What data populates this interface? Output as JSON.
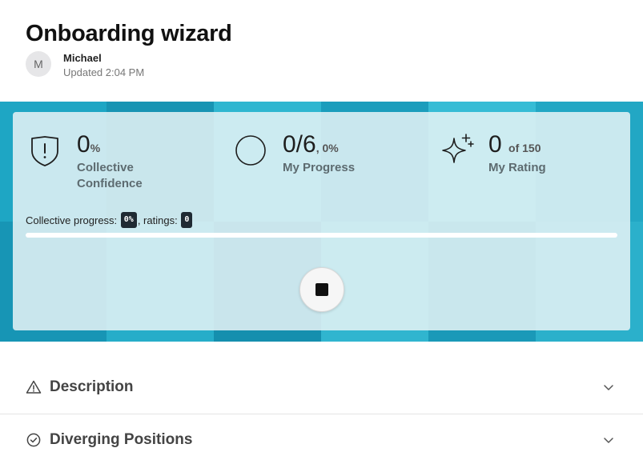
{
  "header": {
    "title": "Onboarding wizard",
    "avatar_initial": "M",
    "author": "Michael",
    "updated": "Updated 2:04 PM"
  },
  "stats": {
    "confidence": {
      "value": "0",
      "unit": "%",
      "label_line1": "Collective",
      "label_line2": "Confidence",
      "icon": "shield-alert-icon"
    },
    "progress": {
      "value": "0/6",
      "suffix": ", 0%",
      "label": "My Progress",
      "icon": "circle-icon"
    },
    "rating": {
      "value": "0",
      "suffix": "of 150",
      "label": "My Rating",
      "icon": "sparkles-icon"
    }
  },
  "collective": {
    "prefix": "Collective progress:",
    "progress_badge": "0%",
    "middle": ", ratings:",
    "ratings_badge": "0",
    "progress_fraction": 0
  },
  "controls": {
    "stop_icon": "stop-icon"
  },
  "sections": [
    {
      "title": "Description",
      "icon": "warning-triangle-icon"
    },
    {
      "title": "Diverging Positions",
      "icon": "check-circle-icon"
    }
  ],
  "colors": {
    "band_base": "#24aecb",
    "accent": "#1f9eb9",
    "badge_bg": "#1f2a33"
  }
}
